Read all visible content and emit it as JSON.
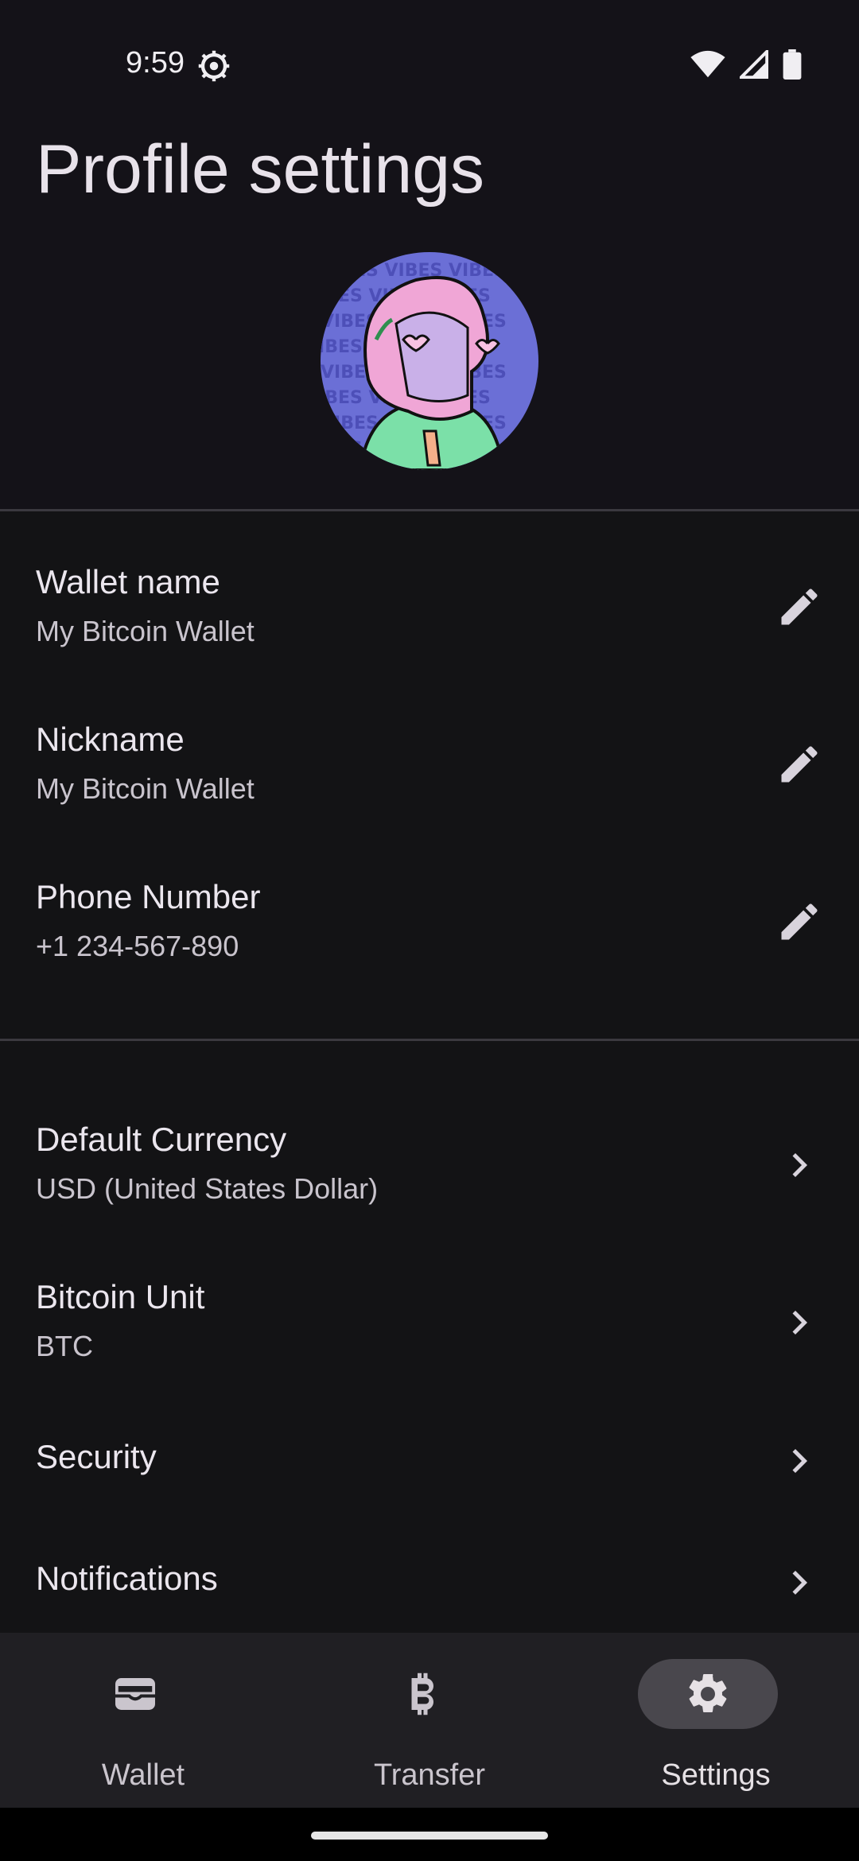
{
  "status_bar": {
    "time": "9:59"
  },
  "header": {
    "title": "Profile settings"
  },
  "profile_fields": [
    {
      "title": "Wallet name",
      "value": "My Bitcoin Wallet",
      "action_icon": "pencil-icon"
    },
    {
      "title": "Nickname",
      "value": "My Bitcoin Wallet",
      "action_icon": "pencil-icon"
    },
    {
      "title": "Phone Number",
      "value": "+1 234-567-890",
      "action_icon": "pencil-icon"
    }
  ],
  "preferences": [
    {
      "title": "Default Currency",
      "value": "USD (United States Dollar)",
      "action_icon": "chevron-right-icon"
    },
    {
      "title": "Bitcoin Unit",
      "value": "BTC",
      "action_icon": "chevron-right-icon"
    },
    {
      "title": "Security",
      "action_icon": "chevron-right-icon"
    },
    {
      "title": "Notifications",
      "action_icon": "chevron-right-icon"
    }
  ],
  "bottom_nav": {
    "items": [
      {
        "label": "Wallet",
        "icon": "wallet-icon",
        "active": false
      },
      {
        "label": "Transfer",
        "icon": "bitcoin-icon",
        "active": false
      },
      {
        "label": "Settings",
        "icon": "gear-icon",
        "active": true
      }
    ]
  },
  "colors": {
    "background": "#141316",
    "nav_background": "#201f23",
    "active_pill": "#49474d",
    "avatar_background": "#6b6fd6",
    "text_primary": "#e6e1e5",
    "text_secondary": "#c9c4cd"
  }
}
